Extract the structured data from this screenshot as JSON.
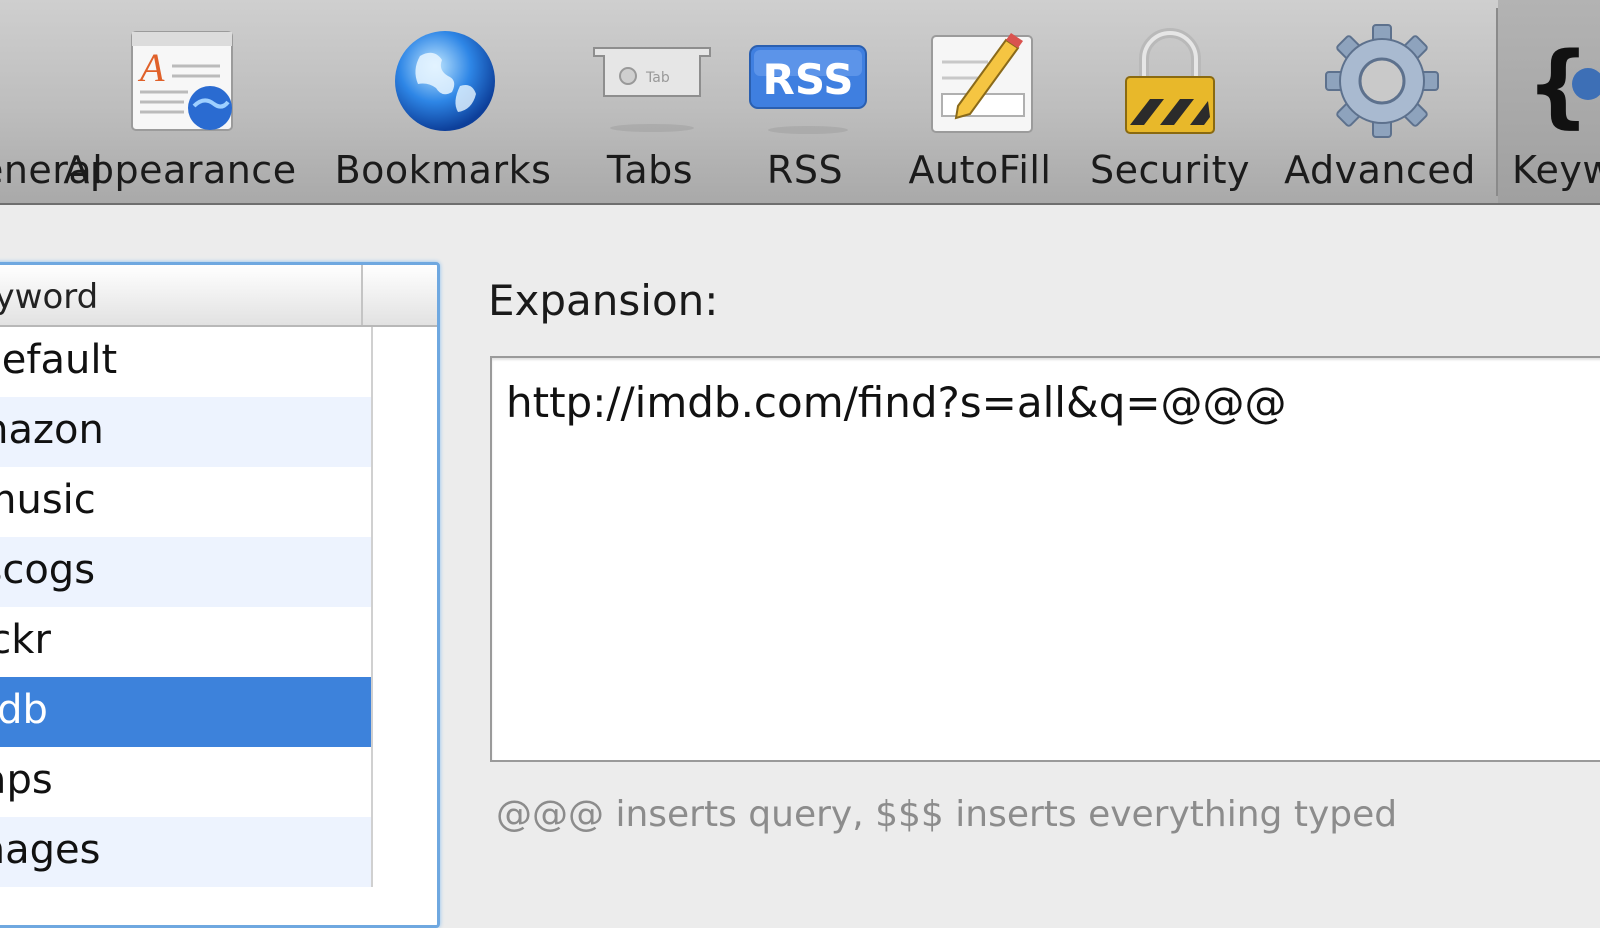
{
  "toolbar": {
    "items": [
      {
        "label": "General",
        "icon": "general-switch-icon"
      },
      {
        "label": "Appearance",
        "icon": "appearance-font-icon"
      },
      {
        "label": "Bookmarks",
        "icon": "globe-icon"
      },
      {
        "label": "Tabs",
        "icon": "tab-icon"
      },
      {
        "label": "RSS",
        "icon": "rss-icon"
      },
      {
        "label": "AutoFill",
        "icon": "autofill-pencil-icon"
      },
      {
        "label": "Security",
        "icon": "lock-icon"
      },
      {
        "label": "Advanced",
        "icon": "gear-icon"
      },
      {
        "label": "Keywords",
        "icon": "braces-icon"
      }
    ],
    "rss_badge_text": "RSS",
    "tab_badge_text": "Tab"
  },
  "keyword_list": {
    "column_header": "Keyword",
    "rows": [
      "Default",
      "amazon",
      "amusic",
      "discogs",
      "flickr",
      "imdb",
      "maps",
      "images"
    ],
    "selected_index": 5
  },
  "expansion": {
    "label": "Expansion:",
    "value": "http://imdb.com/find?s=all&q=@@@",
    "hint": "@@@ inserts query, $$$ inserts everything typed"
  },
  "colors": {
    "selection": "#3d82db",
    "focus_ring": "#6fa8e0",
    "rss_badge": "#3f7fe0"
  }
}
